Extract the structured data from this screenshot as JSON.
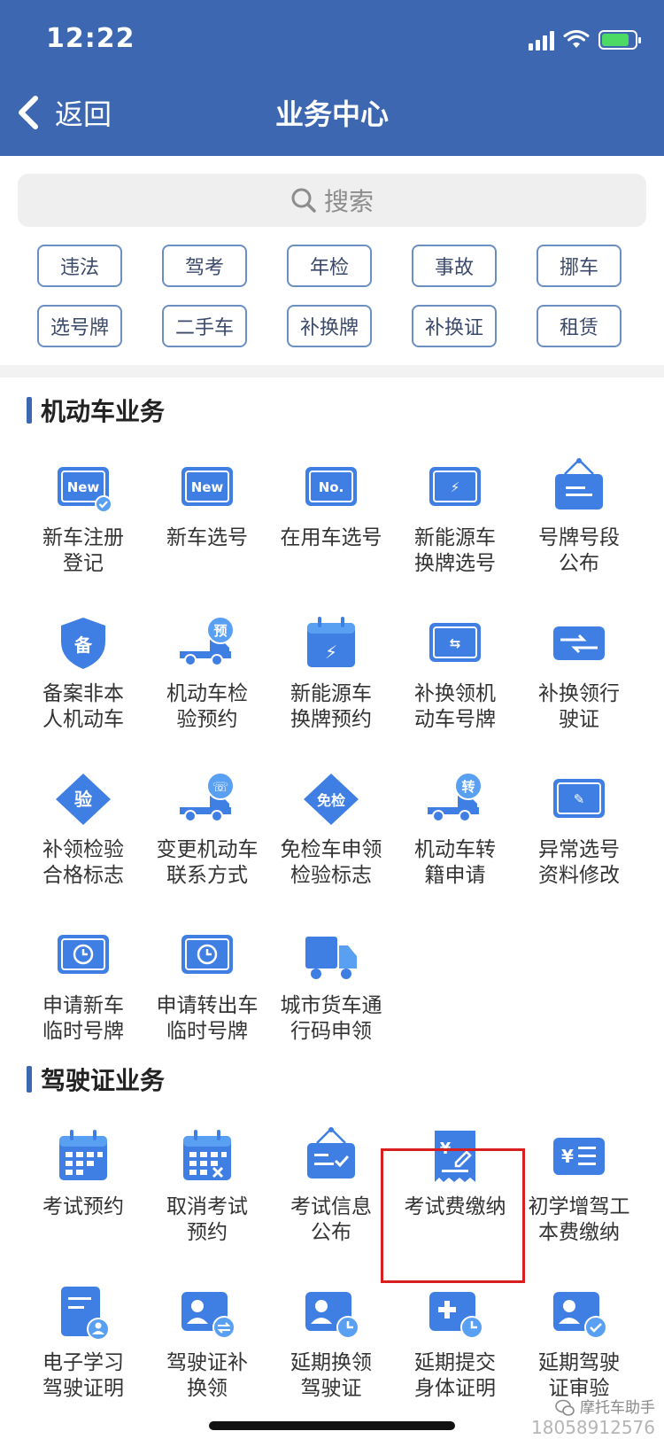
{
  "status_bar": {
    "time": "12:22"
  },
  "nav": {
    "back_label": "返回",
    "title": "业务中心"
  },
  "search": {
    "placeholder": "搜索"
  },
  "tags": [
    "违法",
    "驾考",
    "年检",
    "事故",
    "挪车",
    "选号牌",
    "二手车",
    "补换牌",
    "补换证",
    "租赁"
  ],
  "motor_section": {
    "title": "机动车业务",
    "items": [
      {
        "line1": "新车注册",
        "line2": "登记",
        "icon": "new-plate-check-icon",
        "icon_text": "New"
      },
      {
        "line1": "新车选号",
        "line2": "",
        "icon": "new-plate-icon",
        "icon_text": "New"
      },
      {
        "line1": "在用车选号",
        "line2": "",
        "icon": "number-plate-icon",
        "icon_text": "No."
      },
      {
        "line1": "新能源车",
        "line2": "换牌选号",
        "icon": "ev-plate-icon",
        "icon_text": "⚡"
      },
      {
        "line1": "号牌号段",
        "line2": "公布",
        "icon": "hanging-sign-icon",
        "icon_text": ""
      },
      {
        "line1": "备案非本",
        "line2": "人机动车",
        "icon": "shield-icon",
        "icon_text": "备"
      },
      {
        "line1": "机动车检",
        "line2": "验预约",
        "icon": "truck-search-icon",
        "icon_text": "预"
      },
      {
        "line1": "新能源车",
        "line2": "换牌预约",
        "icon": "calendar-bolt-icon",
        "icon_text": "⚡"
      },
      {
        "line1": "补换领机",
        "line2": "动车号牌",
        "icon": "plate-swap-icon",
        "icon_text": "⇆"
      },
      {
        "line1": "补换领行",
        "line2": "驶证",
        "icon": "license-swap-icon",
        "icon_text": "⇆"
      },
      {
        "line1": "补领检验",
        "line2": "合格标志",
        "icon": "diamond-badge-icon",
        "icon_text": "验"
      },
      {
        "line1": "变更机动车",
        "line2": "联系方式",
        "icon": "truck-phone-icon",
        "icon_text": "☏"
      },
      {
        "line1": "免检车申领",
        "line2": "检验标志",
        "icon": "diamond-badge-icon",
        "icon_text": "免检"
      },
      {
        "line1": "机动车转",
        "line2": "籍申请",
        "icon": "truck-transfer-icon",
        "icon_text": "转"
      },
      {
        "line1": "异常选号",
        "line2": "资料修改",
        "icon": "plate-edit-icon",
        "icon_text": "✎"
      },
      {
        "line1": "申请新车",
        "line2": "临时号牌",
        "icon": "temp-plate-clock-icon",
        "icon_text": "◷"
      },
      {
        "line1": "申请转出车",
        "line2": "临时号牌",
        "icon": "temp-plate-clock-icon",
        "icon_text": "◷"
      },
      {
        "line1": "城市货车通",
        "line2": "行码申领",
        "icon": "cargo-truck-icon",
        "icon_text": ""
      }
    ]
  },
  "license_section": {
    "title": "驾驶证业务",
    "items": [
      {
        "line1": "考试预约",
        "line2": "",
        "icon": "calendar-grid-icon",
        "icon_text": ""
      },
      {
        "line1": "取消考试",
        "line2": "预约",
        "icon": "calendar-cancel-icon",
        "icon_text": ""
      },
      {
        "line1": "考试信息",
        "line2": "公布",
        "icon": "hanging-sign-check-icon",
        "icon_text": ""
      },
      {
        "line1": "考试费缴纳",
        "line2": "",
        "icon": "receipt-pay-icon",
        "icon_text": "¥"
      },
      {
        "line1": "初学增驾工",
        "line2": "本费缴纳",
        "icon": "yen-list-icon",
        "icon_text": "¥"
      },
      {
        "line1": "电子学习",
        "line2": "驾驶证明",
        "icon": "document-user-icon",
        "icon_text": ""
      },
      {
        "line1": "驾驶证补",
        "line2": "换领",
        "icon": "id-card-swap-icon",
        "icon_text": ""
      },
      {
        "line1": "延期换领",
        "line2": "驾驶证",
        "icon": "id-card-clock-icon",
        "icon_text": ""
      },
      {
        "line1": "延期提交",
        "line2": "身体证明",
        "icon": "medical-clock-icon",
        "icon_text": ""
      },
      {
        "line1": "延期驾驶",
        "line2": "证审验",
        "icon": "id-card-check-icon",
        "icon_text": ""
      }
    ]
  },
  "watermark": {
    "title": "摩托车助手",
    "number": "18058912576"
  },
  "colors": {
    "primary": "#3d68b1",
    "icon_blue": "#3f7fe4",
    "highlight_red": "#d81e1e"
  }
}
